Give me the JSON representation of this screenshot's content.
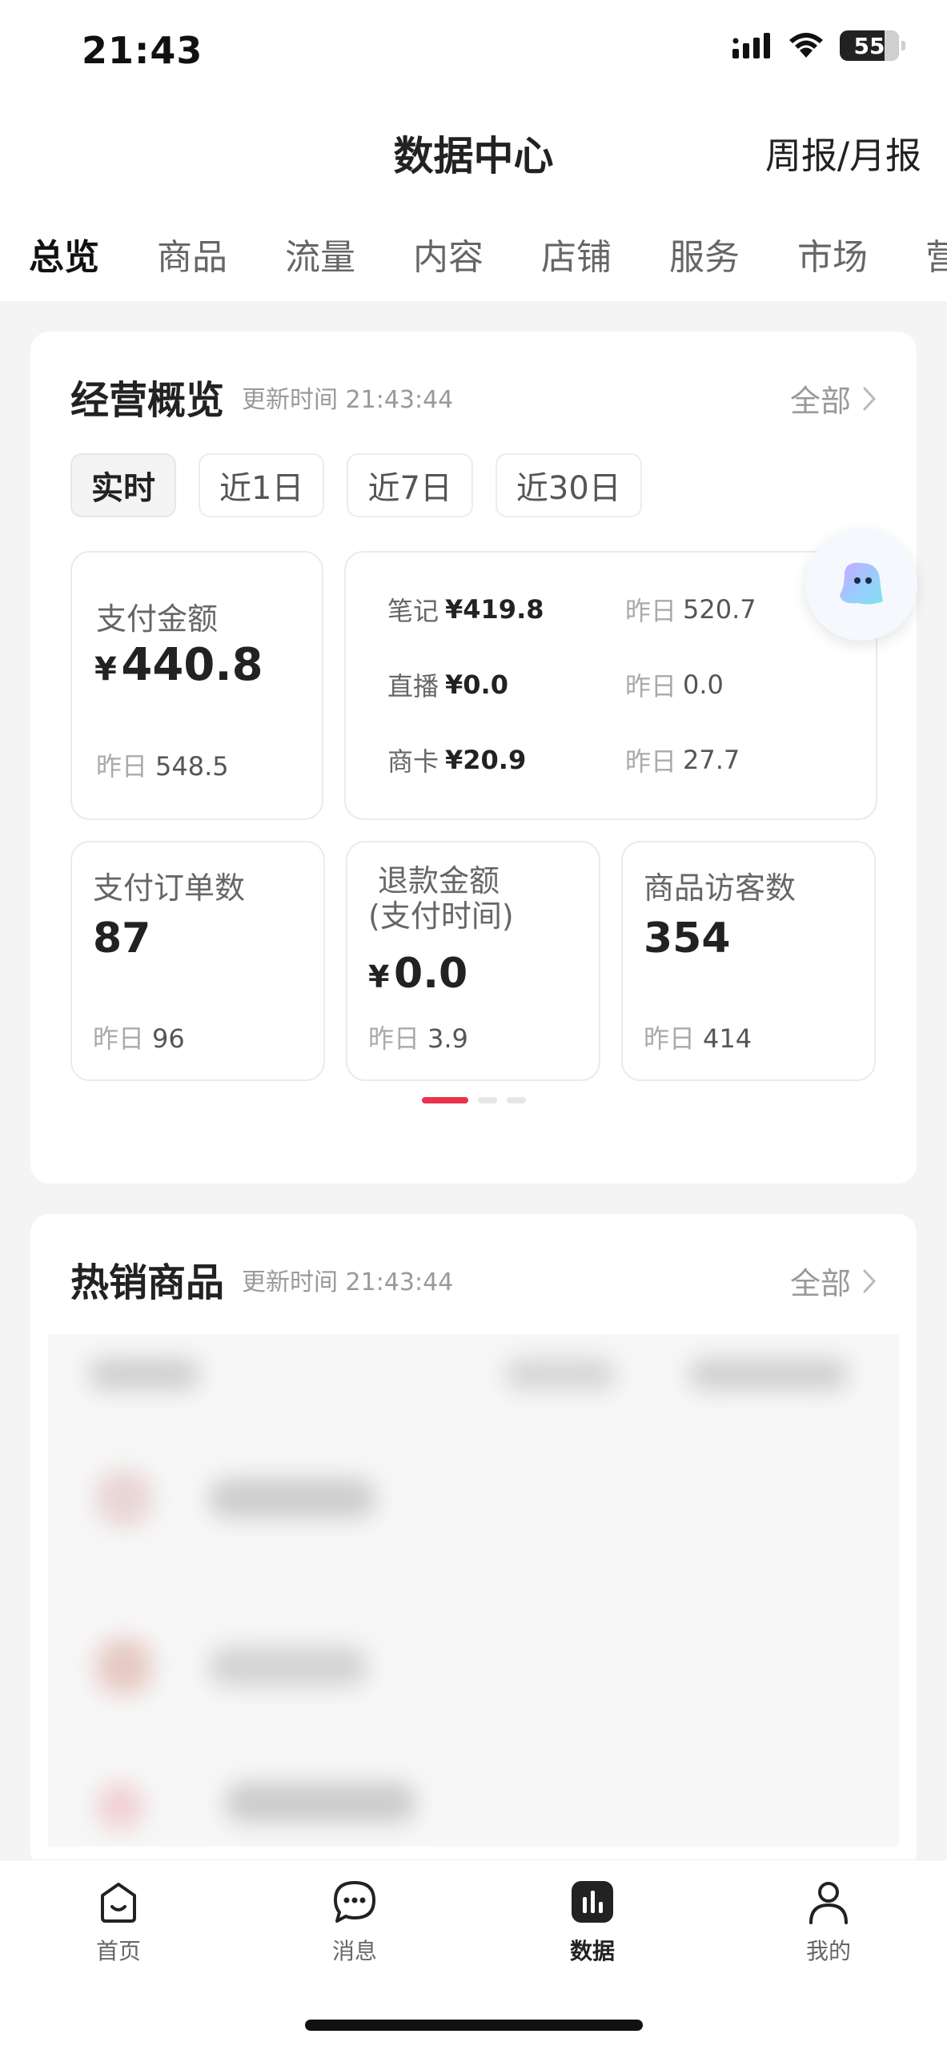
{
  "status_bar": {
    "time": "21:43",
    "battery": "55"
  },
  "header": {
    "title": "数据中心",
    "report_link": "周报/月报"
  },
  "tabs": [
    {
      "label": "总览",
      "active": true
    },
    {
      "label": "商品"
    },
    {
      "label": "流量"
    },
    {
      "label": "内容"
    },
    {
      "label": "店铺"
    },
    {
      "label": "服务"
    },
    {
      "label": "市场"
    },
    {
      "label": "营"
    }
  ],
  "overview": {
    "title": "经营概览",
    "update_time": "更新时间 21:43:44",
    "see_all": "全部",
    "periods": [
      {
        "label": "实时",
        "active": true
      },
      {
        "label": "近1日"
      },
      {
        "label": "近7日"
      },
      {
        "label": "近30日"
      }
    ],
    "pay_amount": {
      "label": "支付金额",
      "currency": "¥",
      "value": "440.8",
      "yesterday_label": "昨日",
      "yesterday": "548.5"
    },
    "breakdown": [
      {
        "label": "笔记",
        "value": "¥419.8",
        "yesterday_label": "昨日",
        "yesterday": "520.7"
      },
      {
        "label": "直播",
        "value": "¥0.0",
        "yesterday_label": "昨日",
        "yesterday": "0.0"
      },
      {
        "label": "商卡",
        "value": "¥20.9",
        "yesterday_label": "昨日",
        "yesterday": "27.7"
      }
    ],
    "orders": {
      "label": "支付订单数",
      "value": "87",
      "yesterday_label": "昨日",
      "yesterday": "96"
    },
    "refund": {
      "label_line1": "退款金额",
      "label_line2": "(支付时间)",
      "currency": "¥",
      "value": "0.0",
      "yesterday_label": "昨日",
      "yesterday": "3.9"
    },
    "visitors": {
      "label": "商品访客数",
      "value": "354",
      "yesterday_label": "昨日",
      "yesterday": "414"
    },
    "pager": {
      "pages": 3,
      "active": 1
    }
  },
  "hot_products": {
    "title": "热销商品",
    "update_time": "更新时间 21:43:44",
    "see_all": "全部"
  },
  "tabbar": [
    {
      "label": "首页",
      "icon": "home-icon"
    },
    {
      "label": "消息",
      "icon": "message-icon"
    },
    {
      "label": "数据",
      "icon": "data-chart-icon",
      "active": true
    },
    {
      "label": "我的",
      "icon": "profile-icon"
    }
  ],
  "colors": {
    "accent": "#e8344e",
    "background": "#f4f4f5"
  }
}
